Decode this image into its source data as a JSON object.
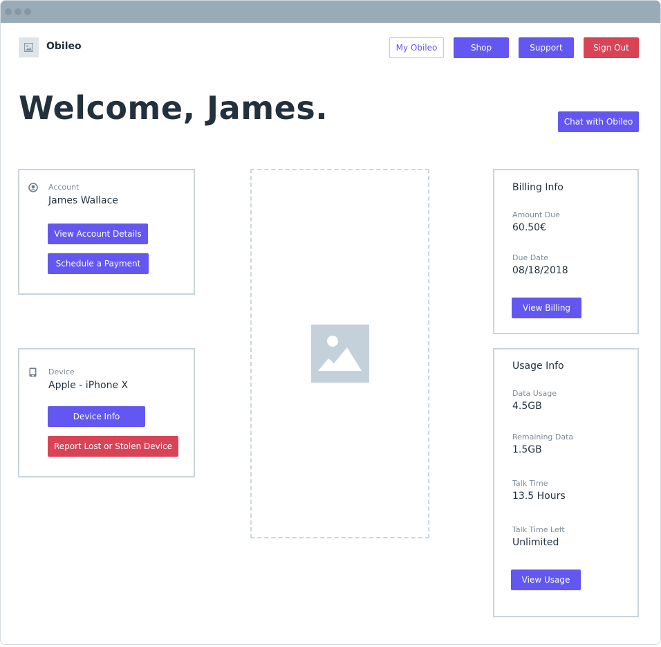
{
  "window": {
    "title_dots": [
      "close",
      "minimize",
      "maximize"
    ]
  },
  "header": {
    "brand_name": "Obileo",
    "logo_icon": "image-icon",
    "nav": {
      "my_obileo": "My Obileo",
      "shop": "Shop",
      "support": "Support",
      "sign_out": "Sign Out"
    }
  },
  "hero": {
    "welcome": "Welcome, James.",
    "chat_button": "Chat with Obileo"
  },
  "account": {
    "icon": "user-circle-icon",
    "label": "Account",
    "name": "James Wallace",
    "buttons": {
      "view_details": "View Account Details",
      "schedule_payment": "Schedule a Payment"
    }
  },
  "device": {
    "icon": "phone-icon",
    "label": "Device",
    "name": "Apple - iPhone X",
    "buttons": {
      "info": "Device Info",
      "report_lost": "Report Lost or Stolen Device"
    }
  },
  "placeholder": {
    "icon": "image-placeholder-icon"
  },
  "billing": {
    "title": "Billing Info",
    "amount_due_label": "Amount Due",
    "amount_due": "60.50€",
    "due_date_label": "Due Date",
    "due_date": "08/18/2018",
    "button": "View Billing"
  },
  "usage": {
    "title": "Usage Info",
    "data_usage_label": "Data Usage",
    "data_usage": "4.5GB",
    "remaining_data_label": "Remaining Data",
    "remaining_data": "1.5GB",
    "talk_time_label": "Talk Time",
    "talk_time": "13.5 Hours",
    "talk_time_left_label": "Talk Time Left",
    "talk_time_left": "Unlimited",
    "button": "View Usage"
  },
  "colors": {
    "primary": "#6257f0",
    "danger": "#d94356",
    "titlebar": "#9aabb8",
    "card_border": "#c9d4dc",
    "text_dark": "#23313e",
    "text_muted": "#7d8a96"
  }
}
